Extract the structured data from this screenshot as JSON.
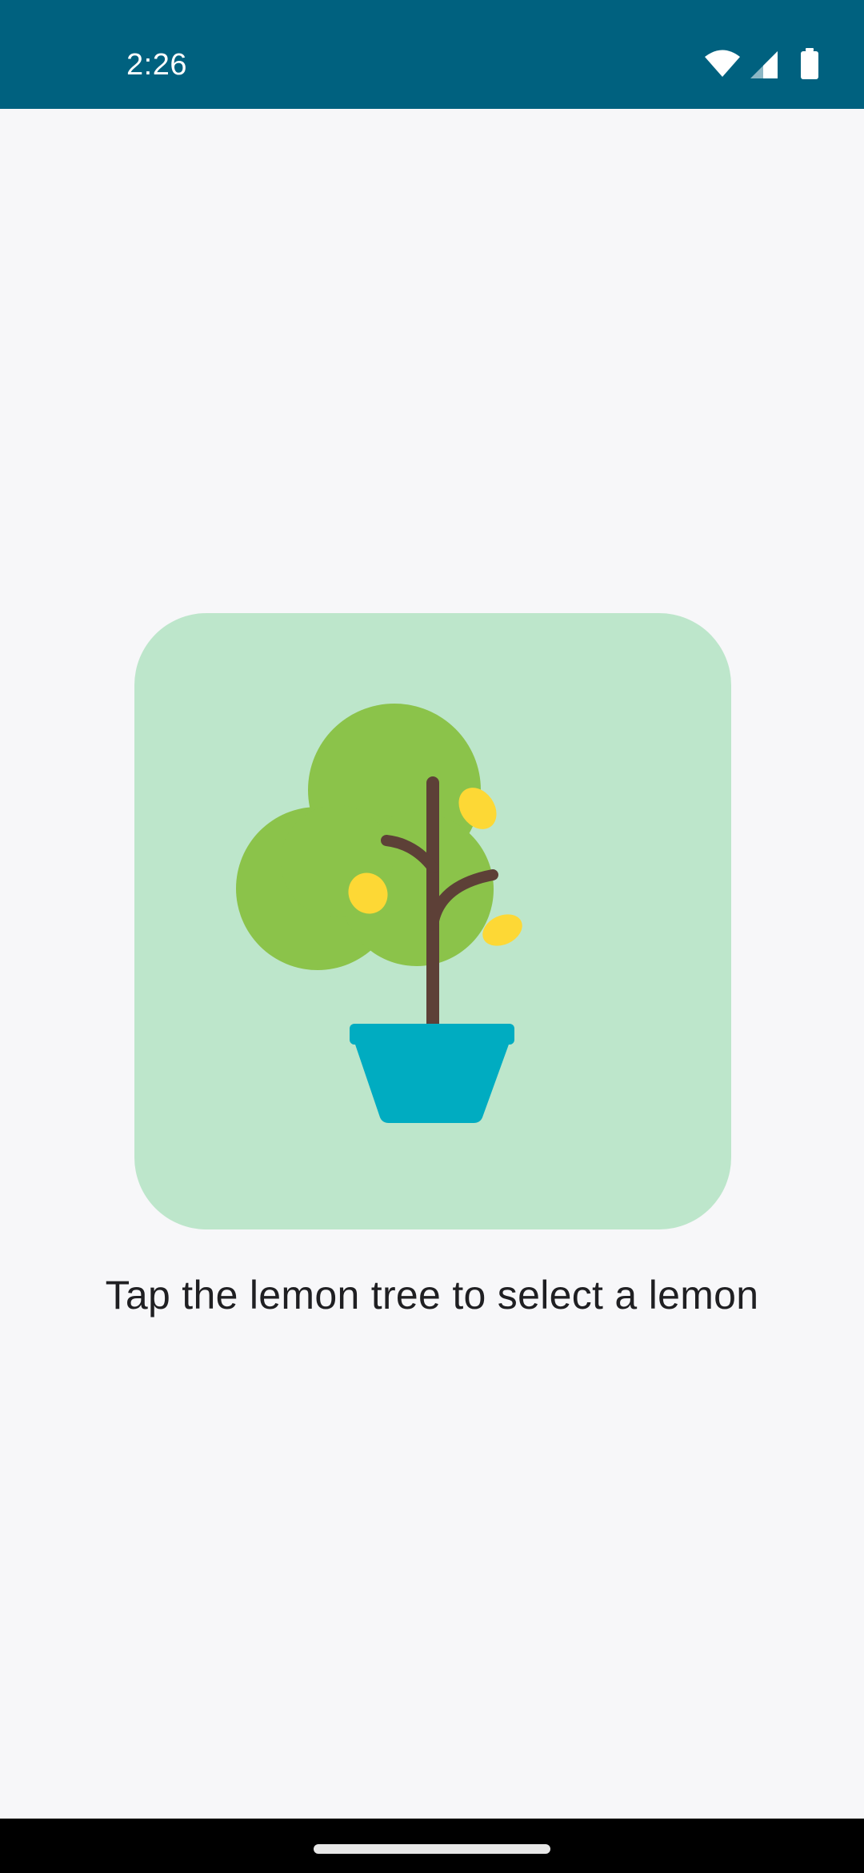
{
  "status_bar": {
    "time": "2:26",
    "background_color": "#00617f",
    "icons": [
      "wifi-icon",
      "cell-signal-icon",
      "battery-icon"
    ]
  },
  "main": {
    "image_button": {
      "icon": "lemon-tree-icon",
      "background_color": "#bde6cb"
    },
    "instruction": "Tap the lemon tree to select a lemon"
  },
  "nav_bar": {
    "handle": "gesture-handle"
  }
}
